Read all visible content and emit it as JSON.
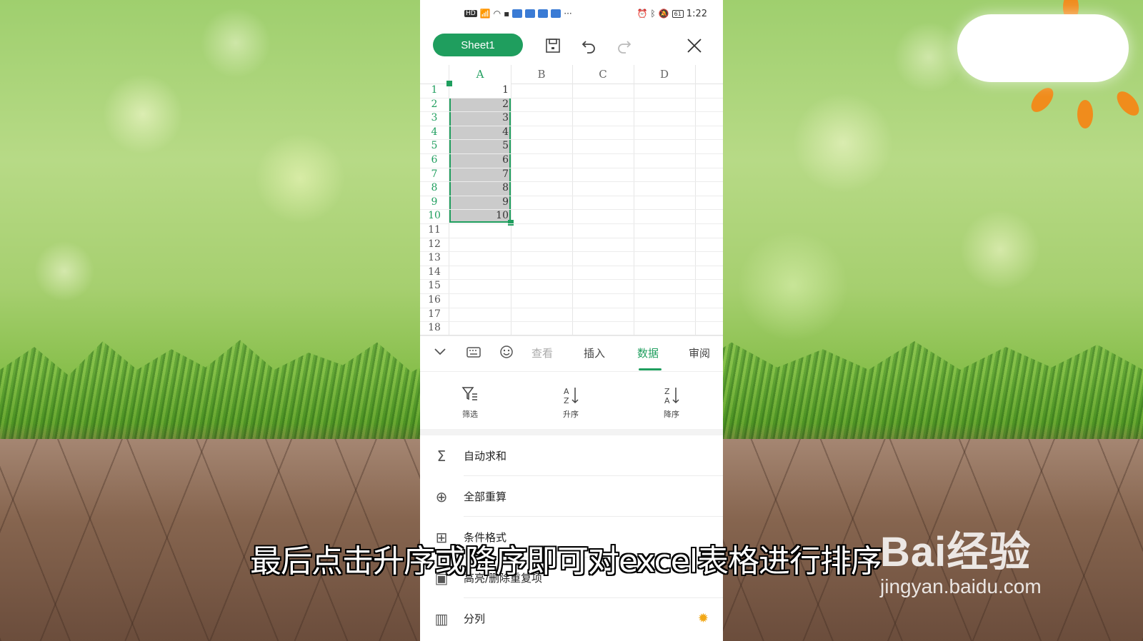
{
  "status_bar": {
    "time": "1:22",
    "signal_label": "HD",
    "battery_level": "61"
  },
  "toolbar": {
    "sheet_tab": "Sheet1"
  },
  "columns": [
    "A",
    "B",
    "C",
    "D"
  ],
  "rows": [
    "1",
    "2",
    "3",
    "4",
    "5",
    "6",
    "7",
    "8",
    "9",
    "10",
    "11",
    "12",
    "13",
    "14",
    "15",
    "16",
    "17",
    "18"
  ],
  "cells_A": [
    "1",
    "2",
    "3",
    "4",
    "5",
    "6",
    "7",
    "8",
    "9",
    "10"
  ],
  "tabs": {
    "view": "查看",
    "insert": "插入",
    "data": "数据",
    "review": "审阅"
  },
  "data_tools": {
    "filter": "筛选",
    "ascending": "升序",
    "descending": "降序"
  },
  "menu": {
    "auto_sum": "自动求和",
    "recalc_all": "全部重算",
    "conditional_format": "条件格式",
    "highlight_duplicates": "高亮/删除重复项",
    "split_column": "分列"
  },
  "caption": "最后点击升序或降序即可对excel表格进行排序",
  "watermark": {
    "brand": "Bai经验",
    "url": "jingyan.baidu.com"
  },
  "colors": {
    "accent": "#1f9e5e"
  }
}
